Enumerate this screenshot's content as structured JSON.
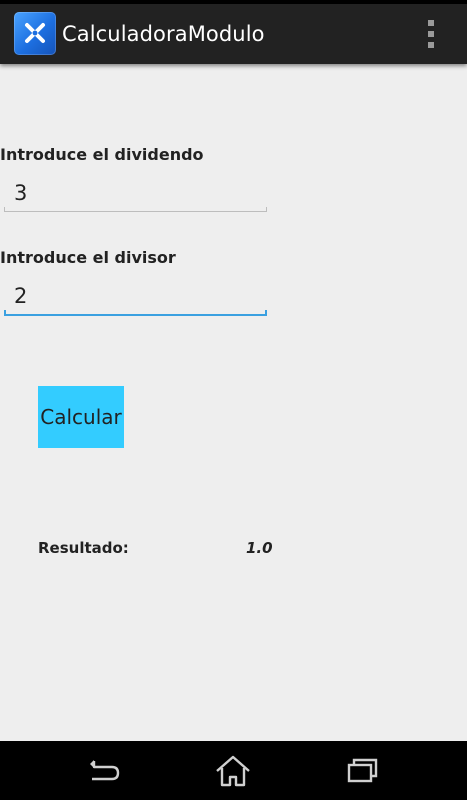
{
  "action_bar": {
    "icon": "app-logo-icon",
    "title": "CalculadoraModulo",
    "overflow_icon": "overflow-menu-icon"
  },
  "form": {
    "dividend": {
      "label": "Introduce el dividendo",
      "value": "3"
    },
    "divisor": {
      "label": "Introduce el divisor",
      "value": "2"
    },
    "calculate_button": "Calcular"
  },
  "result": {
    "label": "Resultado:",
    "value": "1.0"
  },
  "navigation": {
    "back_icon": "back-icon",
    "home_icon": "home-icon",
    "recents_icon": "recent-apps-icon"
  },
  "colors": {
    "action_bar": "#222222",
    "background": "#eeeeee",
    "button": "#33ccff",
    "focus_underline": "#3aa0e0",
    "nav_bar": "#000000"
  }
}
